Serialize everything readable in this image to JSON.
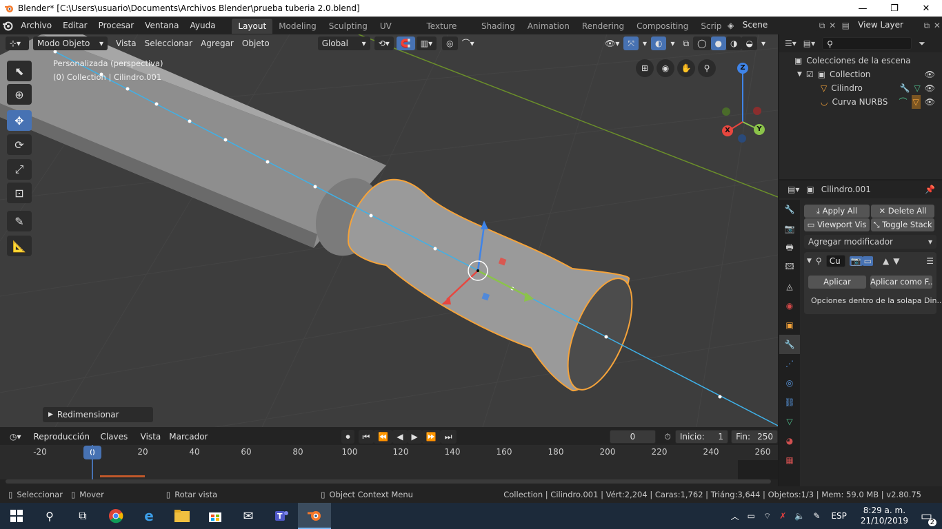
{
  "titlebar": {
    "title": "Blender* [C:\\Users\\usuario\\Documents\\Archivos Blender\\prueba tuberia 2.0.blend]",
    "minimize": "—",
    "maximize": "❐",
    "close": "✕"
  },
  "menubar": {
    "items": [
      "Archivo",
      "Editar",
      "Procesar",
      "Ventana",
      "Ayuda"
    ],
    "workspaces": [
      "Layout",
      "Modeling",
      "Sculpting",
      "UV Editing",
      "Texture Paint",
      "Shading",
      "Animation",
      "Rendering",
      "Compositing",
      "Scrip"
    ],
    "active_workspace": "Layout",
    "scene": "Scene",
    "view_layer": "View Layer"
  },
  "viewport_header": {
    "mode": "Modo Objeto",
    "menus": [
      "Vista",
      "Seleccionar",
      "Agregar",
      "Objeto"
    ],
    "orientation": "Global"
  },
  "viewport": {
    "view_name": "Personalizada (perspectiva)",
    "collection_info": "(0) Collection | Cilindro.001",
    "operator_panel": "Redimensionar",
    "gizmo_x": "X",
    "gizmo_y": "Y",
    "gizmo_z": "Z"
  },
  "outliner": {
    "root": "Colecciones de la escena",
    "collection": "Collection",
    "items": [
      "Cilindro",
      "Curva NURBS"
    ]
  },
  "properties": {
    "object_name": "Cilindro.001",
    "apply_all": "Apply All",
    "delete_all": "Delete All",
    "viewport_vis": "Viewport Vis",
    "toggle_stack": "Toggle Stack",
    "add_modifier": "Agregar modificador",
    "modifier_name": "Cu",
    "apply": "Aplicar",
    "apply_as": "Aplicar como F..",
    "options_note": "Opciones dentro de la solapa Din.."
  },
  "timeline": {
    "menus": [
      "Reproducción",
      "Claves",
      "Vista",
      "Marcador"
    ],
    "current_frame": "0",
    "start_label": "Inicio:",
    "start": "1",
    "end_label": "Fin:",
    "end": "250",
    "ticks": [
      "-20",
      "0",
      "20",
      "40",
      "60",
      "80",
      "100",
      "120",
      "140",
      "160",
      "180",
      "200",
      "220",
      "240",
      "260"
    ]
  },
  "statusbar": {
    "select": "Seleccionar",
    "move": "Mover",
    "rotate": "Rotar vista",
    "context_menu": "Object Context Menu",
    "stats": "Collection | Cilindro.001 | Vért:2,204 | Caras:1,762 | Triáng:3,644 | Objetos:1/3 | Mem: 59.0 MB | v2.80.75"
  },
  "taskbar": {
    "language": "ESP",
    "time": "8:29 a. m.",
    "date": "21/10/2019",
    "notifications": "2"
  },
  "colors": {
    "accent": "#4772b3",
    "selection": "#f5a33a",
    "curve": "#3fb1e8",
    "axis_x": "#e8473f",
    "axis_y": "#8bc34a",
    "axis_z": "#3f84e8"
  }
}
